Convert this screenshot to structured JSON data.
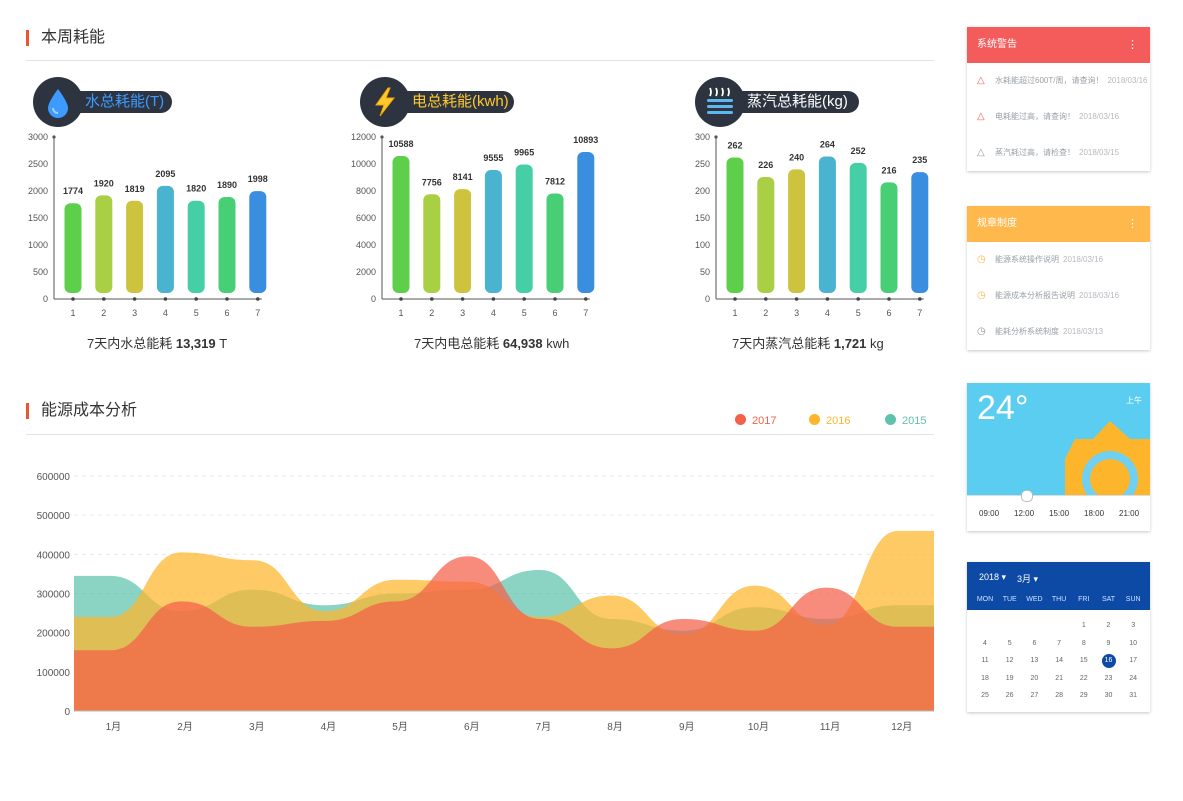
{
  "weekly": {
    "title": "本周耗能",
    "charts": [
      {
        "badge_label": "水总耗能(T)",
        "icon": "water-drop-icon",
        "label_color": "#3d9bff",
        "total_prefix": "7天内水总能耗",
        "total_value": "13,319",
        "total_unit": "T",
        "ymax": 3000,
        "yticks": [
          "3000",
          "2500",
          "2000",
          "1500",
          "1000",
          "500",
          "0"
        ],
        "categories": [
          "1",
          "2",
          "3",
          "4",
          "5",
          "6",
          "7"
        ],
        "values": [
          1774,
          1920,
          1819,
          2095,
          1820,
          1890,
          1998
        ]
      },
      {
        "badge_label": "电总耗能(kwh)",
        "icon": "lightning-icon",
        "label_color": "#ffc82c",
        "total_prefix": "7天内电总能耗",
        "total_value": "64,938",
        "total_unit": "kwh",
        "ymax": 12000,
        "yticks": [
          "12000",
          "10000",
          "8000",
          "6000",
          "4000",
          "2000",
          "0"
        ],
        "categories": [
          "1",
          "2",
          "3",
          "4",
          "5",
          "6",
          "7"
        ],
        "values": [
          10588,
          7756,
          8141,
          9555,
          9965,
          7812,
          10893
        ]
      },
      {
        "badge_label": "蒸汽总耗能(kg)",
        "icon": "steam-icon",
        "label_color": "#ffffff",
        "total_prefix": "7天内蒸汽总能耗",
        "total_value": "1,721",
        "total_unit": "kg",
        "ymax": 300,
        "yticks": [
          "300",
          "250",
          "200",
          "150",
          "100",
          "50",
          "0"
        ],
        "categories": [
          "1",
          "2",
          "3",
          "4",
          "5",
          "6",
          "7"
        ],
        "values": [
          262,
          226,
          240,
          264,
          252,
          216,
          235
        ]
      }
    ],
    "bar_colors": [
      "#5ecf4a",
      "#a9cf45",
      "#cdc33f",
      "#4ab3cf",
      "#46cfa6",
      "#48cf75",
      "#3a8ee0"
    ]
  },
  "cost": {
    "title": "能源成本分析",
    "legend": [
      {
        "label": "2017",
        "color": "#f4604a"
      },
      {
        "label": "2016",
        "color": "#fdb52b"
      },
      {
        "label": "2015",
        "color": "#5ec2ac"
      }
    ]
  },
  "chart_data": {
    "type": "area",
    "x": [
      "1月",
      "2月",
      "3月",
      "4月",
      "5月",
      "6月",
      "7月",
      "8月",
      "9月",
      "10月",
      "11月",
      "12月"
    ],
    "yticks": [
      "600000",
      "500000",
      "400000",
      "300000",
      "200000",
      "100000",
      "0"
    ],
    "ylim": [
      0,
      600000
    ],
    "grid": true,
    "legend_position": "top-right",
    "series": [
      {
        "name": "2015",
        "color": "#5ec2ac",
        "values": [
          345000,
          255000,
          310000,
          270000,
          300000,
          310000,
          360000,
          235000,
          205000,
          265000,
          235000,
          270000
        ]
      },
      {
        "name": "2016",
        "color": "#fdb52b",
        "values": [
          240000,
          405000,
          385000,
          255000,
          335000,
          330000,
          240000,
          295000,
          195000,
          320000,
          220000,
          460000
        ]
      },
      {
        "name": "2017",
        "color": "#f4604a",
        "values": [
          155000,
          280000,
          215000,
          230000,
          280000,
          395000,
          235000,
          160000,
          235000,
          205000,
          315000,
          215000
        ]
      }
    ]
  },
  "alerts": {
    "title": "系统警告",
    "items": [
      {
        "text": "水耗能超过600T/周，请查询！",
        "date": "2018/03/16"
      },
      {
        "text": "电耗能过高，请查询！",
        "date": "2018/03/16"
      },
      {
        "text": "蒸汽耗过高，请检查！",
        "date": "2018/03/15"
      }
    ]
  },
  "rules": {
    "title": "规章制度",
    "items": [
      {
        "text": "能源系统操作说明",
        "date": "2018/03/16"
      },
      {
        "text": "能源成本分析报告说明",
        "date": "2018/03/16"
      },
      {
        "text": "能耗分析系统制度",
        "date": "2018/03/13"
      }
    ]
  },
  "weather": {
    "temperature": "24°",
    "period": "上午",
    "times": [
      "09:00",
      "12:00",
      "15:00",
      "18:00",
      "21:00"
    ],
    "slider_fraction": 0.25
  },
  "calendar": {
    "year": "2018",
    "month": "3月",
    "dow": [
      "MON",
      "TUE",
      "WED",
      "THU",
      "FRI",
      "SAT",
      "SUN"
    ],
    "first_weekday": 4,
    "days_in_month": 31,
    "today": "16",
    "today_color": "#0d4aa6"
  }
}
